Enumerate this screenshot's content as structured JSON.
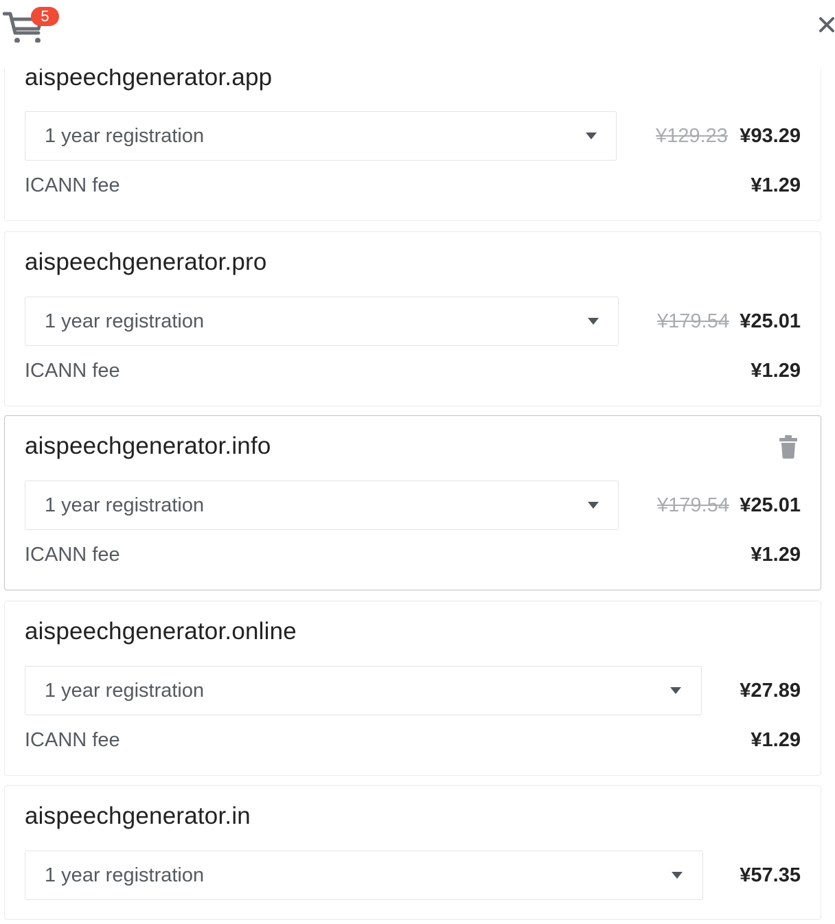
{
  "header": {
    "cart_count": "5",
    "close_label": "×"
  },
  "cart_items": [
    {
      "domain": "aispeechgenerator.app",
      "term": "1 year registration",
      "old_price": "¥129.23",
      "price": "¥93.29",
      "fee_label": "ICANN fee",
      "fee_price": "¥1.29"
    },
    {
      "domain": "aispeechgenerator.pro",
      "term": "1 year registration",
      "old_price": "¥179.54",
      "price": "¥25.01",
      "fee_label": "ICANN fee",
      "fee_price": "¥1.29"
    },
    {
      "domain": "aispeechgenerator.info",
      "term": "1 year registration",
      "old_price": "¥179.54",
      "price": "¥25.01",
      "fee_label": "ICANN fee",
      "fee_price": "¥1.29",
      "action_icon": "trash-icon"
    },
    {
      "domain": "aispeechgenerator.online",
      "term": "1 year registration",
      "price": "¥27.89",
      "fee_label": "ICANN fee",
      "fee_price": "¥1.29"
    },
    {
      "domain": "aispeechgenerator.in",
      "term": "1 year registration",
      "price": "¥57.35"
    }
  ],
  "colors": {
    "badge": "#ef4b35",
    "text": "#222222",
    "muted_text": "#555a60",
    "strikethrough": "#a9acb0"
  }
}
